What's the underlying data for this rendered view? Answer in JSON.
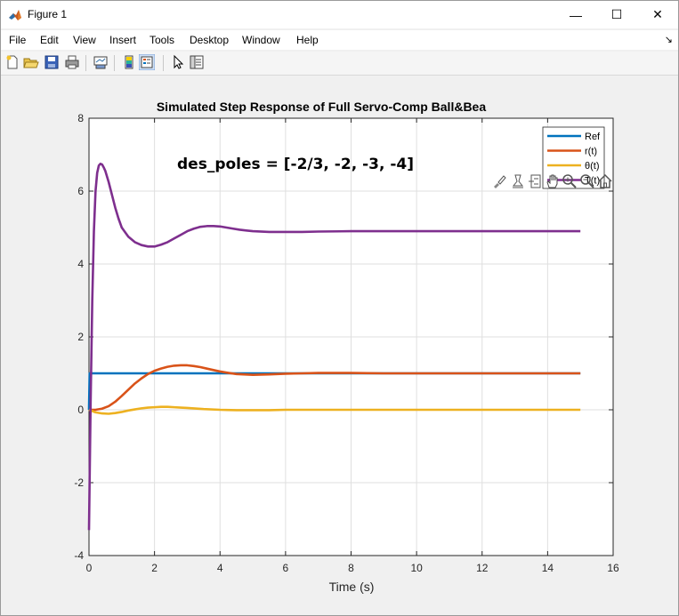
{
  "window": {
    "title": "Figure 1",
    "controls": {
      "minimize": "—",
      "maximize": "☐",
      "close": "✕"
    }
  },
  "menu": {
    "items": [
      "File",
      "Edit",
      "View",
      "Insert",
      "Tools",
      "Desktop",
      "Window",
      "Help"
    ],
    "dock_arrow": "↘"
  },
  "toolbar": {
    "buttons": [
      "new-figure-icon",
      "open-file-icon",
      "save-icon",
      "print-icon",
      "link-plot-icon",
      "insert-colorbar-icon",
      "insert-legend-icon",
      "edit-plot-arrow-icon",
      "property-inspector-icon"
    ]
  },
  "axes_toolbar": {
    "buttons": [
      "brush-icon",
      "data-tips-icon",
      "restore-view-icon",
      "pan-hand-icon",
      "zoom-in-icon",
      "zoom-out-icon",
      "home-icon"
    ]
  },
  "chart_data": {
    "type": "line",
    "title": "Simulated Step Response of Full Servo-Comp Ball&Bea",
    "annotation": "des_poles = [-2/3, -2, -3, -4]",
    "xlabel": "Time (s)",
    "ylabel": "",
    "xlim": [
      0,
      16
    ],
    "ylim": [
      -4,
      8
    ],
    "xticks": [
      0,
      2,
      4,
      6,
      8,
      10,
      12,
      14,
      16
    ],
    "yticks": [
      -4,
      -2,
      0,
      2,
      4,
      6,
      8
    ],
    "grid": true,
    "legend_position": "top-right",
    "series": [
      {
        "name": "Ref",
        "color": "#0072bd",
        "x": [
          0,
          0.02,
          15
        ],
        "y": [
          0,
          1,
          1
        ]
      },
      {
        "name": "r(t)",
        "color": "#d95319",
        "x": [
          0,
          0.2,
          0.4,
          0.6,
          0.8,
          1.0,
          1.2,
          1.4,
          1.6,
          1.8,
          2.0,
          2.2,
          2.4,
          2.6,
          2.8,
          3.0,
          3.2,
          3.4,
          3.6,
          3.8,
          4.0,
          4.2,
          4.5,
          5.0,
          5.5,
          6.0,
          6.5,
          7.0,
          7.5,
          8.0,
          9.0,
          10,
          11,
          12,
          13,
          14,
          15
        ],
        "y": [
          0,
          0.0,
          0.03,
          0.1,
          0.22,
          0.38,
          0.55,
          0.72,
          0.86,
          0.98,
          1.07,
          1.13,
          1.18,
          1.21,
          1.22,
          1.22,
          1.2,
          1.17,
          1.13,
          1.09,
          1.05,
          1.02,
          0.98,
          0.96,
          0.97,
          0.99,
          1.0,
          1.01,
          1.01,
          1.01,
          1.0,
          1.0,
          1.0,
          1.0,
          1.0,
          1.0,
          1.0
        ]
      },
      {
        "name": "θ(t)",
        "color": "#edb120",
        "x": [
          0,
          0.2,
          0.4,
          0.6,
          0.8,
          1.0,
          1.2,
          1.4,
          1.6,
          1.8,
          2.0,
          2.2,
          2.4,
          2.6,
          2.8,
          3.0,
          3.5,
          4.0,
          4.5,
          5.0,
          5.5,
          6.0,
          7.0,
          8.0,
          10,
          12,
          15
        ],
        "y": [
          0,
          -0.07,
          -0.1,
          -0.11,
          -0.09,
          -0.06,
          -0.02,
          0.01,
          0.04,
          0.06,
          0.07,
          0.08,
          0.08,
          0.07,
          0.06,
          0.05,
          0.02,
          0.0,
          -0.01,
          -0.01,
          -0.01,
          0.0,
          0.0,
          0.0,
          0.0,
          0.0,
          0.0
        ]
      },
      {
        "name": "T(t)",
        "color": "#7e2f8e",
        "x": [
          0,
          0.05,
          0.1,
          0.15,
          0.2,
          0.25,
          0.3,
          0.35,
          0.4,
          0.45,
          0.5,
          0.6,
          0.7,
          0.8,
          0.9,
          1.0,
          1.2,
          1.4,
          1.6,
          1.8,
          2.0,
          2.2,
          2.4,
          2.6,
          2.8,
          3.0,
          3.2,
          3.4,
          3.6,
          3.8,
          4.0,
          4.2,
          4.4,
          4.6,
          4.8,
          5.0,
          5.5,
          6.0,
          6.5,
          7.0,
          8.0,
          9.0,
          10,
          11,
          12,
          13,
          14,
          15
        ],
        "y": [
          -3.3,
          0.2,
          3.0,
          4.9,
          6.0,
          6.5,
          6.7,
          6.75,
          6.73,
          6.65,
          6.55,
          6.25,
          5.9,
          5.55,
          5.25,
          5.0,
          4.75,
          4.6,
          4.52,
          4.48,
          4.48,
          4.53,
          4.6,
          4.7,
          4.8,
          4.9,
          4.97,
          5.02,
          5.04,
          5.04,
          5.03,
          5.0,
          4.97,
          4.94,
          4.92,
          4.9,
          4.88,
          4.88,
          4.88,
          4.89,
          4.9,
          4.9,
          4.9,
          4.9,
          4.9,
          4.9,
          4.9,
          4.9
        ]
      }
    ]
  }
}
